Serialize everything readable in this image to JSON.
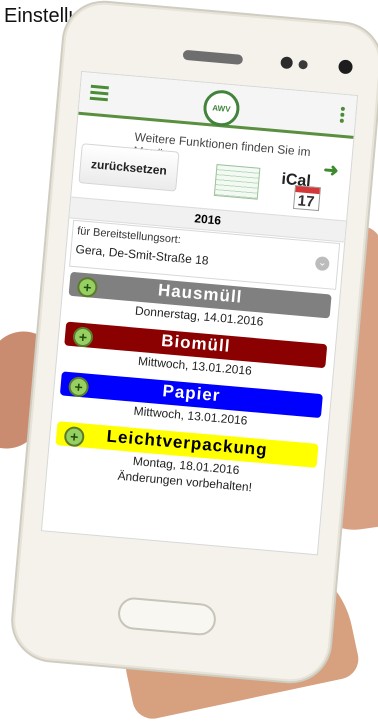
{
  "annotation": {
    "label": "Einstellungen"
  },
  "app": {
    "logo_text": "AWV",
    "info_text": "Weitere Funktionen finden Sie im Menü.",
    "reset_label": "zurücksetzen",
    "ical_label": "iCal",
    "ical_date": "17",
    "year": "2016",
    "location_label": "für Bereitstellungsort:",
    "location_value": "Gera, De-Smit-Straße 18"
  },
  "pickups": [
    {
      "name": "Hausmüll",
      "date": "Donnerstag, 14.01.2016"
    },
    {
      "name": "Biomüll",
      "date": "Mittwoch, 13.01.2016"
    },
    {
      "name": "Papier",
      "date": "Mittwoch, 13.01.2016"
    },
    {
      "name": "Leichtverpackung",
      "date": "Montag, 18.01.2016"
    }
  ],
  "footer_note": "Änderungen vorbehalten!",
  "colors": {
    "annotation_arrow": "#ff4d1f",
    "hausmuell": "#808080",
    "biomuell": "#8b0000",
    "papier": "#0000ff",
    "leichtverpackung": "#ffff00"
  }
}
